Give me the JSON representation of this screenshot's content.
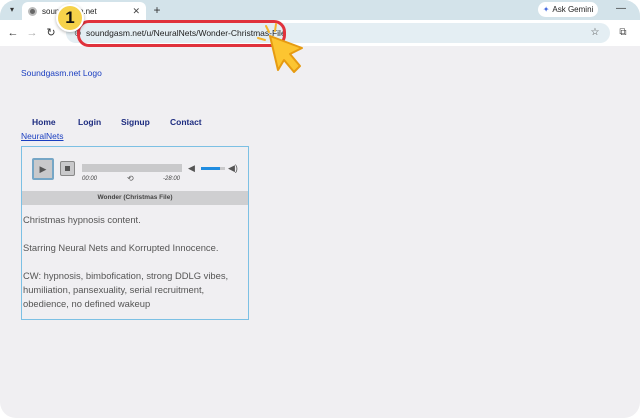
{
  "browser": {
    "tab": {
      "title": "soundgasm.net"
    },
    "new_tab_label": "+",
    "gemini_label": "Ask Gemini",
    "minimize_label": "—",
    "url": "soundgasm.net/u/NeuralNets/Wonder-Christmas-File"
  },
  "annotation": {
    "step_number": "1",
    "ring_color": "#e0323c",
    "badge_color": "#f6d24a"
  },
  "page": {
    "logo_text": "Soundgasm.net Logo",
    "nav": [
      {
        "label": "Home"
      },
      {
        "label": "Login"
      },
      {
        "label": "Signup"
      },
      {
        "label": "Contact"
      }
    ],
    "user_link": "NeuralNets",
    "player": {
      "play_icon": "play-icon",
      "time_current": "00:00",
      "time_remaining": "-28:00",
      "volume_level": 0.8,
      "track_title": "Wonder (Christmas File)"
    },
    "description": [
      "Christmas hypnosis content.",
      "Starring Neural Nets and Korrupted Innocence.",
      "CW: hypnosis, bimbofication, strong DDLG vibes, humiliation, pansexuality, serial recruitment, obedience, no defined wakeup"
    ],
    "link_color": "#1a3ec0",
    "border_color": "#7cc0e4"
  }
}
